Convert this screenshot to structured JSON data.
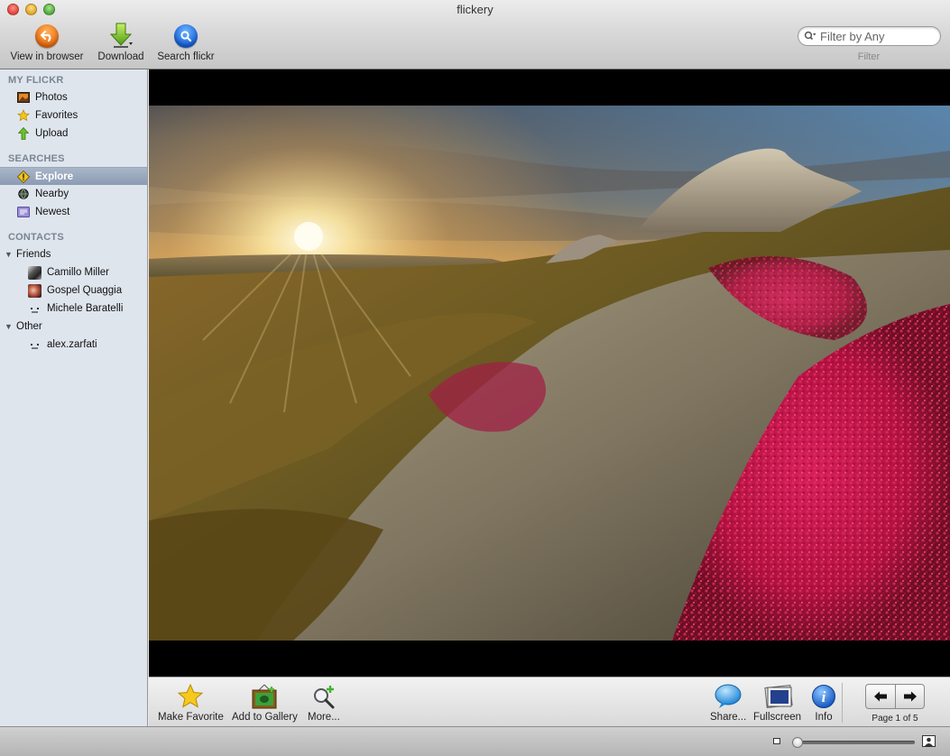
{
  "window": {
    "title": "flickery"
  },
  "toolbar": {
    "view_in_browser": "View in browser",
    "download": "Download",
    "search_flickr": "Search flickr",
    "filter_placeholder": "Filter by Any",
    "filter_label": "Filter"
  },
  "sidebar": {
    "my_flickr": {
      "heading": "MY FLICKR",
      "items": [
        {
          "label": "Photos",
          "icon": "photos-icon"
        },
        {
          "label": "Favorites",
          "icon": "star-icon"
        },
        {
          "label": "Upload",
          "icon": "upload-arrow-icon"
        }
      ]
    },
    "searches": {
      "heading": "SEARCHES",
      "items": [
        {
          "label": "Explore",
          "icon": "explore-warning-icon",
          "selected": true
        },
        {
          "label": "Nearby",
          "icon": "globe-icon"
        },
        {
          "label": "Newest",
          "icon": "newest-icon"
        }
      ]
    },
    "contacts": {
      "heading": "CONTACTS",
      "groups": [
        {
          "label": "Friends",
          "items": [
            {
              "label": "Camillo Miller"
            },
            {
              "label": "Gospel Quaggia"
            },
            {
              "label": "Michele Baratelli"
            }
          ]
        },
        {
          "label": "Other",
          "items": [
            {
              "label": "alex.zarfati"
            }
          ]
        }
      ]
    }
  },
  "bottombar": {
    "make_favorite": "Make Favorite",
    "add_to_gallery": "Add to Gallery",
    "more": "More...",
    "share": "Share...",
    "fullscreen": "Fullscreen",
    "info": "Info",
    "page_label": "Page 1 of 5"
  },
  "zoom": {
    "level": 0.0
  },
  "colors": {
    "sidebar_bg": "#dfe5ed",
    "selection": "#8b9bb3",
    "heather": "#c4154a"
  }
}
